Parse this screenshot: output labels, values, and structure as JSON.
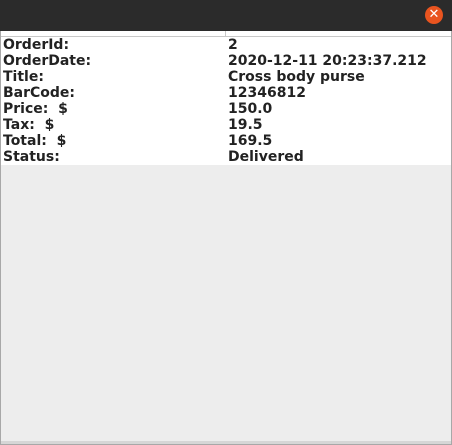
{
  "window": {
    "close_glyph": "✕"
  },
  "order": {
    "rows": [
      {
        "label": "OrderId:",
        "value": "2"
      },
      {
        "label": "OrderDate:",
        "value": "2020-12-11 20:23:37.212"
      },
      {
        "label": "Title:",
        "value": "Cross body purse"
      },
      {
        "label": "BarCode:",
        "value": "12346812"
      },
      {
        "label": "Price:  $",
        "value": "150.0"
      },
      {
        "label": "Tax:  $",
        "value": "19.5"
      },
      {
        "label": "Total:  $",
        "value": "169.5"
      },
      {
        "label": "Status:",
        "value": "Delivered"
      }
    ]
  },
  "colors": {
    "titlebar": "#2b2b2b",
    "close_button": "#e9541f",
    "background": "#ededed"
  }
}
